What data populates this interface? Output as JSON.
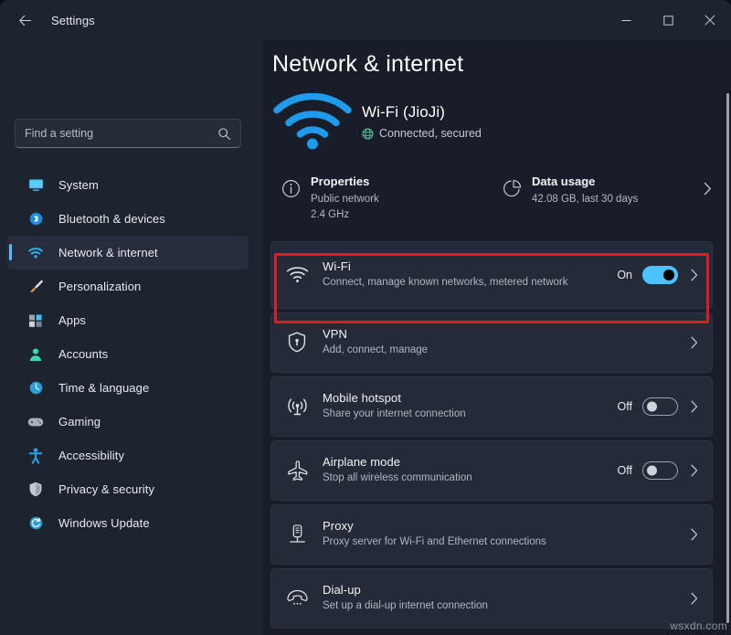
{
  "window": {
    "title": "Settings",
    "back_icon": "arrow-left-icon",
    "caption": {
      "minimize": "minimize-icon",
      "maximize": "maximize-icon",
      "close": "close-icon"
    }
  },
  "search": {
    "placeholder": "Find a setting",
    "icon": "search-icon"
  },
  "sidebar": {
    "items": [
      {
        "label": "System",
        "icon": "monitor-icon",
        "active": false
      },
      {
        "label": "Bluetooth & devices",
        "icon": "bluetooth-icon",
        "active": false
      },
      {
        "label": "Network & internet",
        "icon": "wifi-icon",
        "active": true
      },
      {
        "label": "Personalization",
        "icon": "paintbrush-icon",
        "active": false
      },
      {
        "label": "Apps",
        "icon": "apps-icon",
        "active": false
      },
      {
        "label": "Accounts",
        "icon": "person-icon",
        "active": false
      },
      {
        "label": "Time & language",
        "icon": "clock-icon",
        "active": false
      },
      {
        "label": "Gaming",
        "icon": "gamepad-icon",
        "active": false
      },
      {
        "label": "Accessibility",
        "icon": "accessibility-icon",
        "active": false
      },
      {
        "label": "Privacy & security",
        "icon": "shield-icon",
        "active": false
      },
      {
        "label": "Windows Update",
        "icon": "update-icon",
        "active": false
      }
    ]
  },
  "main": {
    "page_title": "Network & internet",
    "hero": {
      "icon": "wifi-large-icon",
      "title": "Wi-Fi (JioJi)",
      "status_icon": "globe-icon",
      "status": "Connected, secured"
    },
    "info_cells": [
      {
        "icon": "info-icon",
        "title": "Properties",
        "sub_line1": "Public network",
        "sub_line2": "2.4 GHz",
        "chevron": false
      },
      {
        "icon": "pie-chart-icon",
        "title": "Data usage",
        "sub_line1": "42.08 GB, last 30 days",
        "sub_line2": "",
        "chevron": true
      }
    ],
    "cards": [
      {
        "icon": "wifi-icon",
        "title": "Wi-Fi",
        "sub": "Connect, manage known networks, metered network",
        "toggle_state": "On",
        "toggle_on": true,
        "chevron": true,
        "highlighted": true
      },
      {
        "icon": "vpn-shield-icon",
        "title": "VPN",
        "sub": "Add, connect, manage",
        "toggle_state": "",
        "toggle_on": null,
        "chevron": true,
        "highlighted": false
      },
      {
        "icon": "hotspot-icon",
        "title": "Mobile hotspot",
        "sub": "Share your internet connection",
        "toggle_state": "Off",
        "toggle_on": false,
        "chevron": true,
        "highlighted": false
      },
      {
        "icon": "airplane-icon",
        "title": "Airplane mode",
        "sub": "Stop all wireless communication",
        "toggle_state": "Off",
        "toggle_on": false,
        "chevron": true,
        "highlighted": false
      },
      {
        "icon": "proxy-server-icon",
        "title": "Proxy",
        "sub": "Proxy server for Wi-Fi and Ethernet connections",
        "toggle_state": "",
        "toggle_on": null,
        "chevron": true,
        "highlighted": false
      },
      {
        "icon": "dialup-phone-icon",
        "title": "Dial-up",
        "sub": "Set up a dial-up internet connection",
        "toggle_state": "",
        "toggle_on": null,
        "chevron": true,
        "highlighted": false
      }
    ]
  },
  "watermark": "wsxdn.com",
  "colors": {
    "accent": "#4cc2ff",
    "highlight_ring": "#e01b1b",
    "window_bg": "#1e2330",
    "main_bg": "#191d29",
    "card_bg": "#252a38"
  }
}
